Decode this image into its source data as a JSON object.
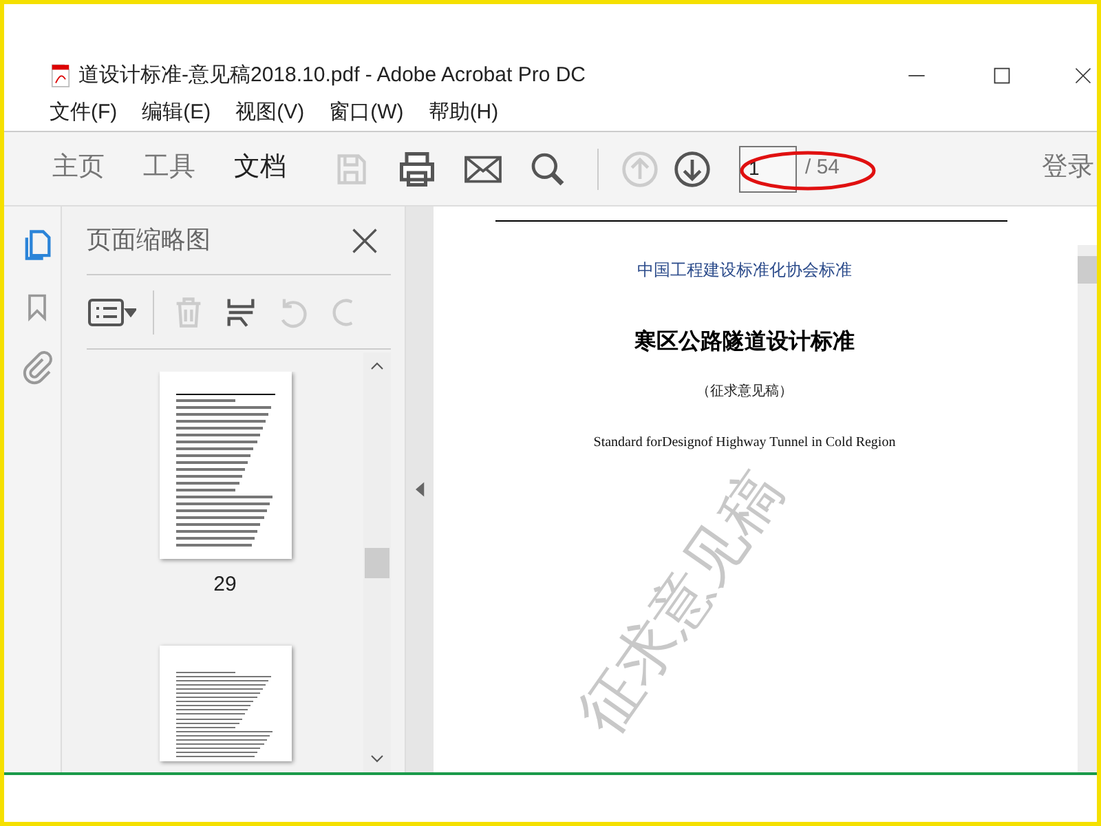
{
  "window": {
    "title": "道设计标准-意见稿2018.10.pdf - Adobe Acrobat Pro DC"
  },
  "menu": [
    "文件(F)",
    "编辑(E)",
    "视图(V)",
    "窗口(W)",
    "帮助(H)"
  ],
  "tabs": [
    {
      "label": "主页",
      "selected": false
    },
    {
      "label": "工具",
      "selected": false
    },
    {
      "label": "文档",
      "selected": true
    }
  ],
  "toolbar": {
    "page_number": "1",
    "page_total": "/ 54",
    "sign_in": "登录",
    "prev_disabled": true,
    "save_disabled": true
  },
  "panel": {
    "title": "页面缩略图",
    "thumbnails": [
      {
        "kind": "full",
        "label": "29"
      },
      {
        "kind": "cut"
      }
    ]
  },
  "document": {
    "org": "中国工程建设标准化协会标准",
    "title": "寒区公路隧道设计标准",
    "subtitle": "（征求意见稿）",
    "english": "Standard forDesignof Highway Tunnel in Cold Region",
    "watermark": "征求意见稿"
  }
}
